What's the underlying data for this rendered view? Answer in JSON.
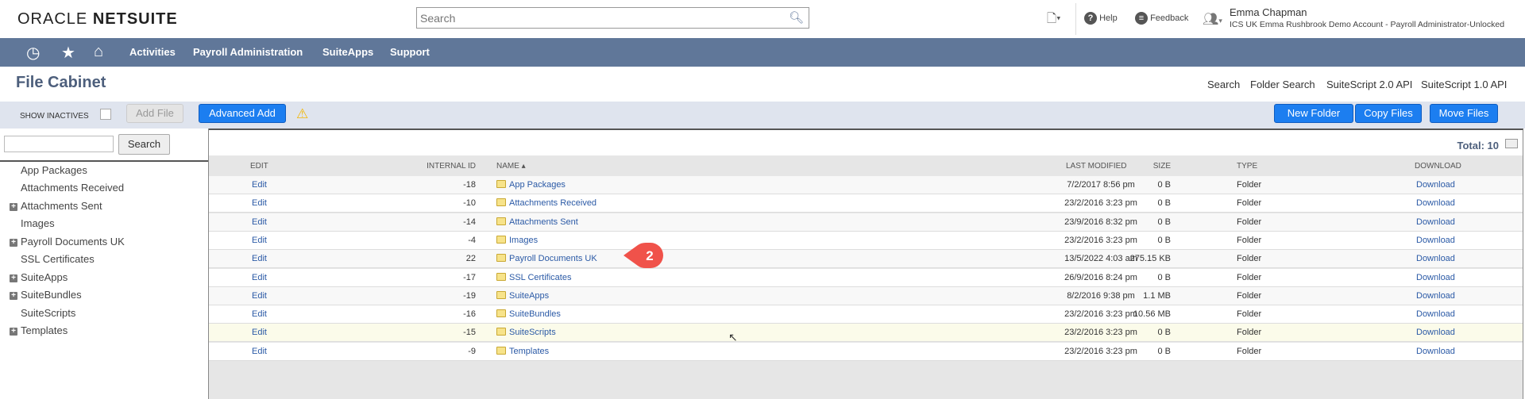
{
  "header": {
    "logo_oracle": "ORACLE",
    "logo_netsuite": "NETSUITE",
    "search_placeholder": "Search",
    "help": "Help",
    "feedback": "Feedback",
    "user_name": "Emma Chapman",
    "user_account": "ICS UK Emma Rushbrook Demo Account - Payroll Administrator-Unlocked"
  },
  "nav": {
    "items": [
      "Activities",
      "Payroll Administration",
      "SuiteApps",
      "Support"
    ]
  },
  "page": {
    "title": "File Cabinet",
    "links": [
      "Search",
      "Folder Search",
      "SuiteScript 2.0 API",
      "SuiteScript 1.0 API"
    ]
  },
  "toolbar": {
    "show_inactives": "SHOW INACTIVES",
    "add_file": "Add File",
    "advanced_add": "Advanced Add",
    "new_folder": "New Folder",
    "copy_files": "Copy Files",
    "move_files": "Move Files"
  },
  "sidebar": {
    "search_label": "Search",
    "items": [
      {
        "label": "App Packages",
        "expandable": false
      },
      {
        "label": "Attachments Received",
        "expandable": false
      },
      {
        "label": "Attachments Sent",
        "expandable": true
      },
      {
        "label": "Images",
        "expandable": false
      },
      {
        "label": "Payroll Documents UK",
        "expandable": true
      },
      {
        "label": "SSL Certificates",
        "expandable": false
      },
      {
        "label": "SuiteApps",
        "expandable": true
      },
      {
        "label": "SuiteBundles",
        "expandable": true
      },
      {
        "label": "SuiteScripts",
        "expandable": false
      },
      {
        "label": "Templates",
        "expandable": true
      }
    ]
  },
  "table": {
    "total": "Total: 10",
    "columns": [
      "EDIT",
      "INTERNAL ID",
      "NAME ▴",
      "SIZE",
      "LAST MODIFIED",
      "TYPE",
      "DOWNLOAD"
    ],
    "rows": [
      {
        "edit": "Edit",
        "id": "-18",
        "name": "App Packages",
        "size": "0 B",
        "modified": "7/2/2017 8:56 pm",
        "type": "Folder",
        "download": "Download"
      },
      {
        "edit": "Edit",
        "id": "-10",
        "name": "Attachments Received",
        "size": "0 B",
        "modified": "23/2/2016 3:23 pm",
        "type": "Folder",
        "download": "Download"
      },
      {
        "edit": "Edit",
        "id": "-14",
        "name": "Attachments Sent",
        "size": "0 B",
        "modified": "23/9/2016 8:32 pm",
        "type": "Folder",
        "download": "Download"
      },
      {
        "edit": "Edit",
        "id": "-4",
        "name": "Images",
        "size": "0 B",
        "modified": "23/2/2016 3:23 pm",
        "type": "Folder",
        "download": "Download"
      },
      {
        "edit": "Edit",
        "id": "22",
        "name": "Payroll Documents UK",
        "size": "275.15 KB",
        "modified": "13/5/2022 4:03 am",
        "type": "Folder",
        "download": "Download"
      },
      {
        "edit": "Edit",
        "id": "-17",
        "name": "SSL Certificates",
        "size": "0 B",
        "modified": "26/9/2016 8:24 pm",
        "type": "Folder",
        "download": "Download"
      },
      {
        "edit": "Edit",
        "id": "-19",
        "name": "SuiteApps",
        "size": "1.1 MB",
        "modified": "8/2/2016 9:38 pm",
        "type": "Folder",
        "download": "Download"
      },
      {
        "edit": "Edit",
        "id": "-16",
        "name": "SuiteBundles",
        "size": "10.56 MB",
        "modified": "23/2/2016 3:23 pm",
        "type": "Folder",
        "download": "Download"
      },
      {
        "edit": "Edit",
        "id": "-15",
        "name": "SuiteScripts",
        "size": "0 B",
        "modified": "23/2/2016 3:23 pm",
        "type": "Folder",
        "download": "Download"
      },
      {
        "edit": "Edit",
        "id": "-9",
        "name": "Templates",
        "size": "0 B",
        "modified": "23/2/2016 3:23 pm",
        "type": "Folder",
        "download": "Download"
      }
    ],
    "highlighted_row": 8
  },
  "annotation": {
    "step": "2",
    "color": "#f0524a"
  },
  "colors": {
    "nav": "#607799",
    "button": "#1c7ef0",
    "link": "#2b5aa6",
    "title": "#4d5f7c"
  }
}
